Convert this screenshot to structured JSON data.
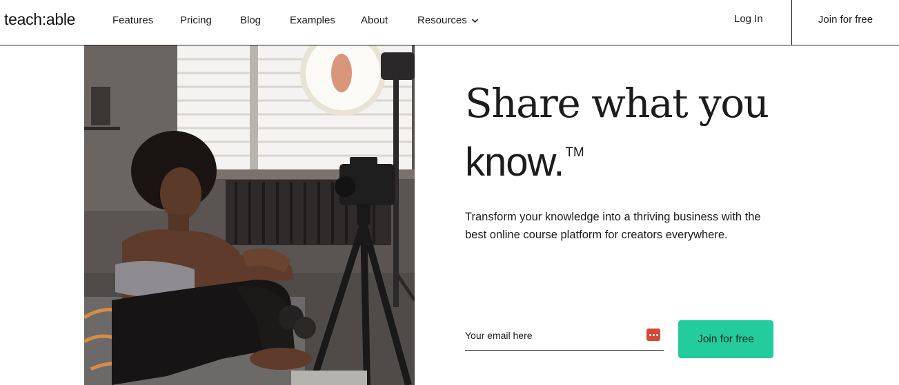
{
  "brand": {
    "logo_text": "teach:able"
  },
  "nav": {
    "items": [
      {
        "label": "Features"
      },
      {
        "label": "Pricing"
      },
      {
        "label": "Blog"
      },
      {
        "label": "Examples"
      },
      {
        "label": "About"
      },
      {
        "label": "Resources",
        "icon": "chevron-down-icon"
      }
    ],
    "login_label": "Log In",
    "join_label": "Join for free"
  },
  "hero": {
    "headline_line1": "Share what you",
    "headline_line2": "know.",
    "trademark": "TM",
    "subcopy": "Transform your knowledge into a thriving business with the best online course platform for creators everywhere.",
    "email_placeholder": "Your email here",
    "email_value": "",
    "password_manager_icon": "password-manager-icon",
    "cta_label": "Join for free",
    "image": "woman-sitting-facing-camera-on-tripod-with-ring-light"
  },
  "colors": {
    "cta_bg": "#22cc9b",
    "text": "#1c1c1c",
    "password_icon": "#d64933"
  }
}
